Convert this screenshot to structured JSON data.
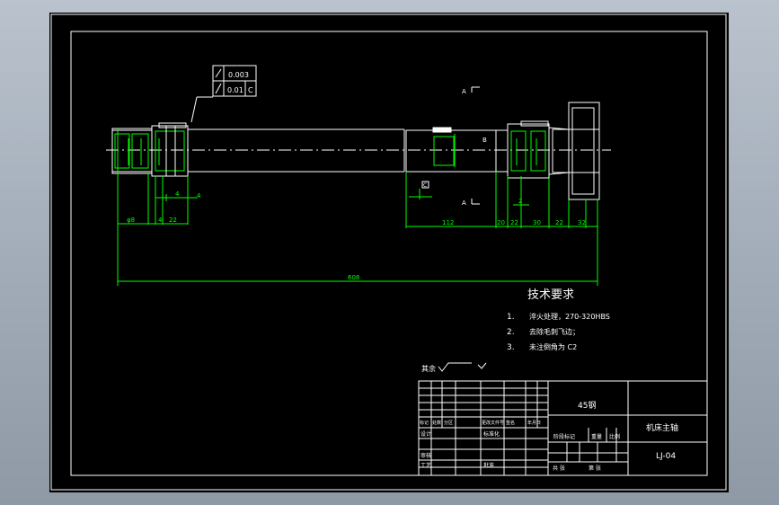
{
  "tolerance": {
    "row1_value": "0.003",
    "row2_value": "0.01",
    "row2_datum": "C"
  },
  "sections": {
    "a_top": "A",
    "a_bottom": "A",
    "b_label": "B",
    "datum_c": "C"
  },
  "dimensions": {
    "d_left_1": "φ8",
    "d_left_2": "4",
    "d_left_3": "22",
    "d_left_4": "4",
    "d_left_5": "4",
    "d_mid": "112",
    "d_r1": "20",
    "d_r2": "22",
    "d_r3": "2",
    "d_r4": "30",
    "d_r5": "22",
    "d_r6": "32",
    "overall": "608"
  },
  "tech": {
    "title": "技术要求",
    "items": [
      {
        "num": "1.",
        "text": "淬火处理，270-320HBS"
      },
      {
        "num": "2.",
        "text": "去除毛刺飞边；"
      },
      {
        "num": "3.",
        "text": "未注倒角为 C2"
      }
    ]
  },
  "surface_note": "其余",
  "title_block": {
    "material": "45钢",
    "part_name": "机床主轴",
    "drawing_no": "LJ-04",
    "stage_mark": "阶段标记",
    "weight": "重量",
    "scale": "比例",
    "design": "设计",
    "check": "审核",
    "process": "工艺",
    "approve": "批准",
    "standard": "标准化",
    "sign": "签名",
    "date": "年月日",
    "mark": "标记",
    "count": "处数",
    "zone": "分区",
    "change_no": "更改文件号",
    "sheet_total": "共   张",
    "sheet_no": "第   张"
  }
}
